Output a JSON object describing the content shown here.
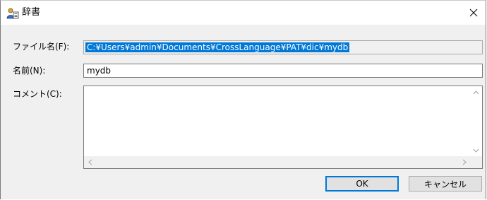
{
  "window": {
    "title": "辞書"
  },
  "form": {
    "file_label": "ファイル名(F):",
    "file_value": "C:¥Users¥admin¥Documents¥CrossLanguage¥PAT¥dic¥mydb",
    "name_label": "名前(N):",
    "name_value": "mydb",
    "comment_label": "コメント(C):",
    "comment_value": ""
  },
  "buttons": {
    "ok": "OK",
    "cancel": "キャンセル"
  },
  "colors": {
    "selection": "#0078d7",
    "face": "#f0f0f0",
    "default_border": "#0078d7"
  }
}
